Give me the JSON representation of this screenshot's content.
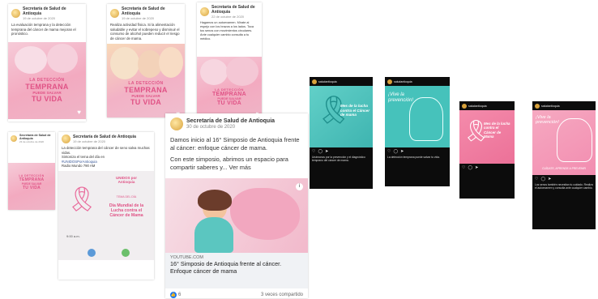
{
  "fb_posts": [
    {
      "author": "Secretaría de Salud de Antioquia",
      "date": "19 de octubre de 2020",
      "text": "La evaluación temprana y la detección temprana del cáncer de mama mejoran el pronóstico.",
      "banner": [
        "LA DETECCIÓN",
        "TEMPRANA",
        "PUEDE SALVAR",
        "TU VIDA"
      ]
    },
    {
      "author": "Secretaría de Salud de Antioquia",
      "date": "19 de octubre de 2020",
      "text": "Realiza actividad física. Si la alimentación saludable y evitar el sobrepeso y disminuir el consumo de alcohol pueden reducir el riesgo de cáncer de mama.",
      "banner": [
        "LA DETECCIÓN",
        "TEMPRANA",
        "PUEDE SALVAR",
        "TU VIDA"
      ]
    },
    {
      "author": "Secretaría de Salud de Antioquia",
      "date": "22 de octubre de 2020",
      "text": "Hagamos un autoexamen. Mírate al espejo con los brazos a los lados. Toca tus senos con movimientos circulares. Ante cualquier cambio consulta a tu médico.",
      "banner": [
        "LA DETECCIÓN",
        "TEMPRANA",
        "PUEDE SALVAR",
        "TU VIDA"
      ]
    },
    {
      "author": "Secretaría de Salud de Antioquia",
      "date": "23 de octubre de 2020",
      "text": "",
      "banner": [
        "LA DETECCIÓN",
        "TEMPRANA",
        "PUEDE SALVAR",
        "TU VIDA"
      ]
    },
    {
      "author": "Secretaría de Salud de Antioquia",
      "date": "19 de octubre de 2020",
      "text": "La detección temprana del cáncer de seno salva muchas vidas.",
      "line2": "Sintoniza el tema del día en",
      "line3": "#UNIDOSPorAntioquia",
      "line4": "Radio Mundo 790 AM",
      "poster_top": "UNIDOS por Antioquia",
      "poster_day": "TEMA DEL DÍA",
      "poster_title": "Día Mundial de la Lucha contra el Cáncer de Mama",
      "poster_time": "9:00 a.m."
    }
  ],
  "featured_post": {
    "author": "Secretaría de Salud de Antioquia",
    "date": "30 de octubre de 2020",
    "text1": "Damos inicio al 16° Simposio de Antioquia frente al cáncer: enfoque cáncer de mama.",
    "text2": "Con este simposio, abrimos un espacio para compartir saberes y... Ver más",
    "source": "YOUTUBE.COM",
    "link_title": "16° Simposio de Antioquia frente al cáncer. Enfoque cáncer de mama",
    "likes": "6",
    "shares": "3 veces compartido"
  },
  "ig_posts": [
    {
      "user": "saludantioquia",
      "pic_text": "Mes de la lucha contra el Cáncer de mama",
      "caption": "Unámonos por la prevención y el diagnóstico temprano del cáncer de mama."
    },
    {
      "user": "saludantioquia",
      "pic_text": "¡Vive la prevención!",
      "caption": "La detección temprana puede salvar tu vida."
    },
    {
      "user": "saludantioquia",
      "pic_text": "Mes de la lucha contra el Cáncer de Mama",
      "caption": ""
    },
    {
      "user": "saludantioquia",
      "pic_text": "¡Vive la prevención!",
      "pic_sub": "CUÍDATE, APRENDE A PREVENIR",
      "caption": "Los senos también necesitan tu cuidado. Realiza el autoexamen y consulta ante cualquier cambio."
    }
  ],
  "colors": {
    "pink": "#f3aac0",
    "accent": "#e05386",
    "teal": "#4fc6c1",
    "fb_blue": "#385898"
  }
}
